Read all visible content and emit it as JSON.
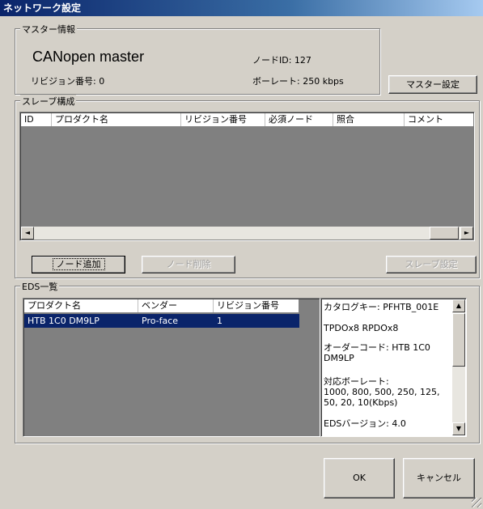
{
  "window": {
    "title": "ネットワーク設定"
  },
  "master": {
    "group_label": "マスター情報",
    "name": "CANopen master",
    "revision_label": "リビジョン番号: 0",
    "node_id_label": "ノードID: 127",
    "baudrate_label": "ボーレート: 250 kbps",
    "settings_button": "マスター設定"
  },
  "slave": {
    "group_label": "スレーブ構成",
    "columns": [
      "ID",
      "プロダクト名",
      "リビジョン番号",
      "必須ノード",
      "照合",
      "コメント"
    ],
    "add_button": "ノード追加",
    "delete_button": "ノード削除",
    "settings_button": "スレーブ設定"
  },
  "eds": {
    "group_label": "EDS一覧",
    "columns": [
      "プロダクト名",
      "ベンダー",
      "リビジョン番号"
    ],
    "rows": [
      {
        "product": "HTB 1C0 DM9LP",
        "vendor": "Pro-face",
        "revision": "1"
      }
    ],
    "info": {
      "catalog": "カタログキー: PFHTB_001E",
      "pdo": "TPDOx8 RPDOx8",
      "order_code": "オーダーコード: HTB 1C0 DM9LP",
      "baud_title": "対応ボーレート:",
      "baud_values": "1000, 800, 500, 250, 125, 50, 20, 10(Kbps)",
      "eds_version": "EDSバージョン: 4.0"
    }
  },
  "footer": {
    "ok_button": "OK",
    "cancel_button": "キャンセル"
  },
  "icons": {
    "scroll_left": "◄",
    "scroll_right": "►",
    "scroll_up": "▲",
    "scroll_down": "▼"
  }
}
